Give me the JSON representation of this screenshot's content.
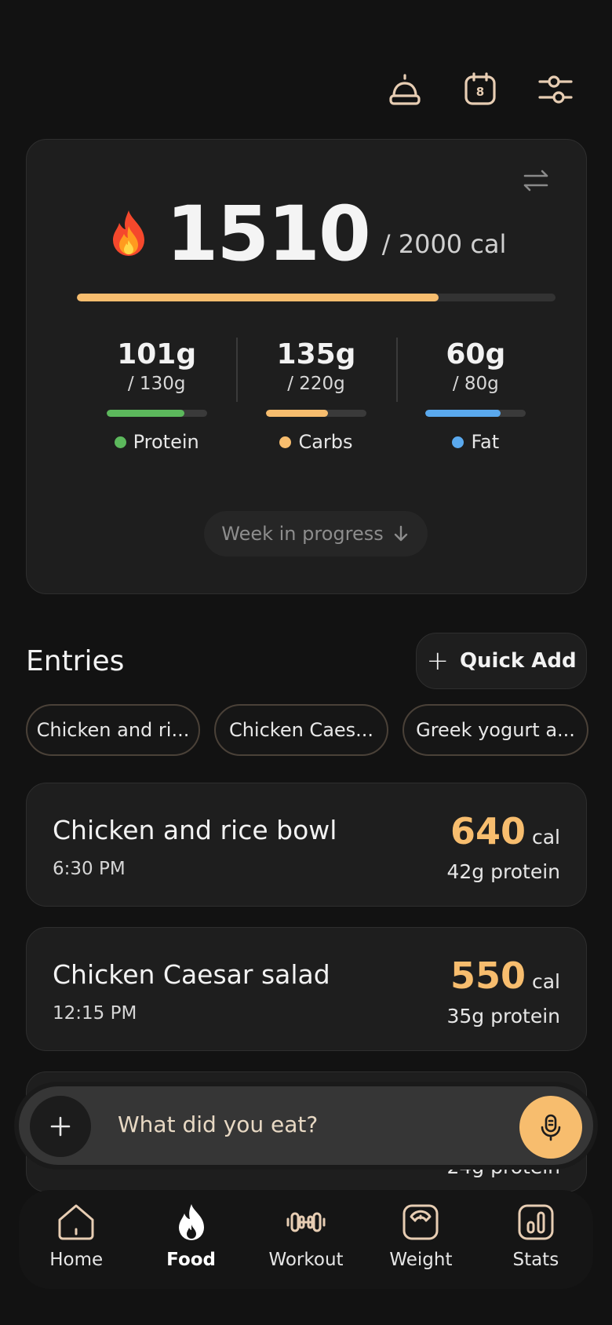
{
  "header": {
    "icons": [
      "bell-icon",
      "calendar-icon",
      "sliders-icon"
    ],
    "calendar_day": "8"
  },
  "summary": {
    "calories_current": "1510",
    "calories_goal_text": "/ 2000 cal",
    "calories_progress": 0.755,
    "macros": [
      {
        "name": "protein",
        "value": "101g",
        "goal": "/ 130g",
        "label": "Protein",
        "color": "#5cb85c",
        "progress": 0.777
      },
      {
        "name": "carbs",
        "value": "135g",
        "goal": "/ 220g",
        "label": "Carbs",
        "color": "#f7bd6e",
        "progress": 0.614
      },
      {
        "name": "fat",
        "value": "60g",
        "goal": "/ 80g",
        "label": "Fat",
        "color": "#5aa9ee",
        "progress": 0.75
      }
    ],
    "week_button": "Week in progress"
  },
  "entries": {
    "title": "Entries",
    "quick_add_label": "Quick Add",
    "chips": [
      "Chicken and ri...",
      "Chicken Caes...",
      "Greek yogurt a..."
    ],
    "items": [
      {
        "name": "Chicken and rice bowl",
        "time": "6:30 PM",
        "calories": "640",
        "unit": "cal",
        "protein": "42g protein"
      },
      {
        "name": "Chicken Caesar salad",
        "time": "12:15 PM",
        "calories": "550",
        "unit": "cal",
        "protein": "35g protein"
      }
    ],
    "partial_item_protein": "24g protein"
  },
  "input": {
    "placeholder": "What did you eat?"
  },
  "nav": {
    "items": [
      {
        "label": "Home",
        "icon": "home-icon"
      },
      {
        "label": "Food",
        "icon": "flame-icon",
        "active": true
      },
      {
        "label": "Workout",
        "icon": "dumbbell-icon"
      },
      {
        "label": "Weight",
        "icon": "scale-icon"
      },
      {
        "label": "Stats",
        "icon": "bar-chart-icon"
      }
    ]
  },
  "colors": {
    "accent": "#f7bd6e",
    "background": "#121212",
    "card": "#1e1e1e"
  }
}
